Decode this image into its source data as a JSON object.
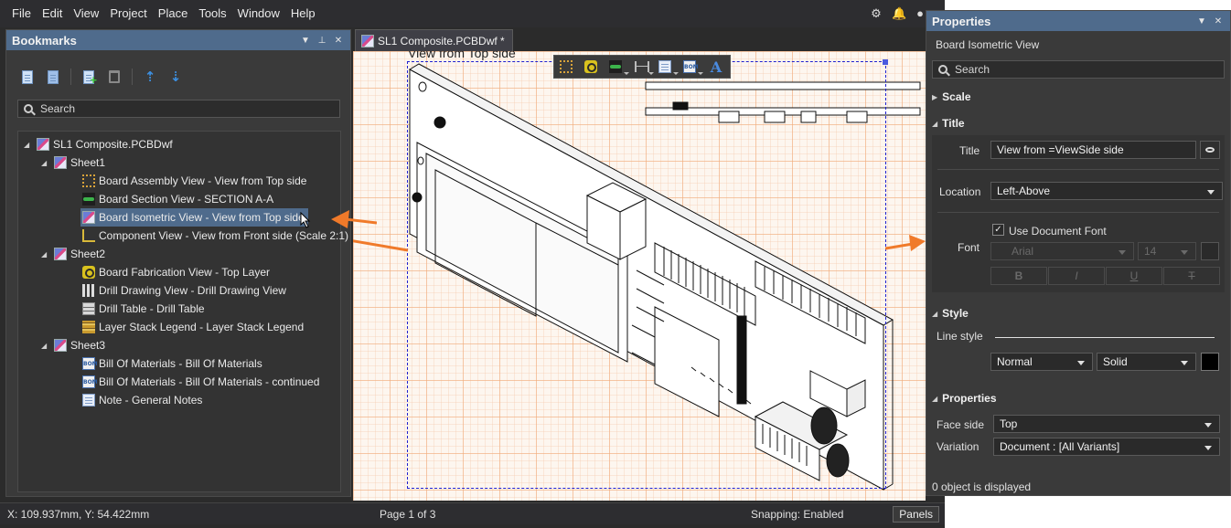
{
  "menu": [
    "File",
    "Edit",
    "View",
    "Project",
    "Place",
    "Tools",
    "Window",
    "Help"
  ],
  "bookmarks": {
    "title": "Bookmarks",
    "search_placeholder": "Search",
    "tree": [
      {
        "label": "SL1 Composite.PCBDwf",
        "icon": "pcb-doc-icon",
        "level": 0,
        "expanded": true
      },
      {
        "label": "Sheet1",
        "icon": "sheet-icon",
        "level": 1,
        "expanded": true
      },
      {
        "label": "Board Assembly View - View from Top side",
        "icon": "board-assembly-icon",
        "level": 2
      },
      {
        "label": "Board Section View - SECTION A-A",
        "icon": "board-section-icon",
        "level": 2
      },
      {
        "label": "Board Isometric View - View from Top side",
        "icon": "board-isometric-icon",
        "level": 2,
        "selected": true
      },
      {
        "label": "Component View - View from Front side (Scale 2:1)",
        "icon": "component-view-icon",
        "level": 2
      },
      {
        "label": "Sheet2",
        "icon": "sheet-icon",
        "level": 1,
        "expanded": true
      },
      {
        "label": "Board Fabrication View - Top Layer",
        "icon": "board-fabrication-icon",
        "level": 2
      },
      {
        "label": "Drill Drawing View - Drill Drawing View",
        "icon": "drill-drawing-icon",
        "level": 2
      },
      {
        "label": "Drill Table - Drill Table",
        "icon": "drill-table-icon",
        "level": 2
      },
      {
        "label": "Layer Stack Legend - Layer Stack Legend",
        "icon": "layer-stack-icon",
        "level": 2
      },
      {
        "label": "Sheet3",
        "icon": "sheet-icon",
        "level": 1,
        "expanded": true
      },
      {
        "label": "Bill Of Materials - Bill Of Materials",
        "icon": "bom-icon",
        "level": 2
      },
      {
        "label": "Bill Of Materials - Bill Of Materials - continued",
        "icon": "bom-icon",
        "level": 2
      },
      {
        "label": "Note - General Notes",
        "icon": "note-icon",
        "level": 2
      }
    ]
  },
  "document": {
    "tab_label": "SL1 Composite.PCBDwf *",
    "view_title": "View from Top side"
  },
  "statusbar": {
    "coords": "X: 109.937mm, Y: 54.422mm",
    "page": "Page 1 of 3",
    "snapping": "Snapping: Enabled",
    "panels_label": "Panels"
  },
  "properties": {
    "title": "Properties",
    "subtitle": "Board Isometric View",
    "search_placeholder": "Search",
    "sections": {
      "scale": "Scale",
      "title": "Title",
      "style": "Style",
      "properties": "Properties"
    },
    "title_label": "Title",
    "title_value": "View from =ViewSide side",
    "location_label": "Location",
    "location_value": "Left-Above",
    "use_doc_font_label": "Use Document Font",
    "use_doc_font_checked": "✓",
    "font_label": "Font",
    "font_name": "Arial",
    "font_size": "14",
    "line_style_label": "Line style",
    "line_width": "Normal",
    "line_type": "Solid",
    "face_side_label": "Face side",
    "face_side_value": "Top",
    "variation_label": "Variation",
    "variation_value": "Document : [All Variants]",
    "footer": "0 object is displayed"
  },
  "colors": {
    "accent": "#4f6b8c",
    "arrow": "#f07a2a",
    "selection": "#2020d0"
  }
}
